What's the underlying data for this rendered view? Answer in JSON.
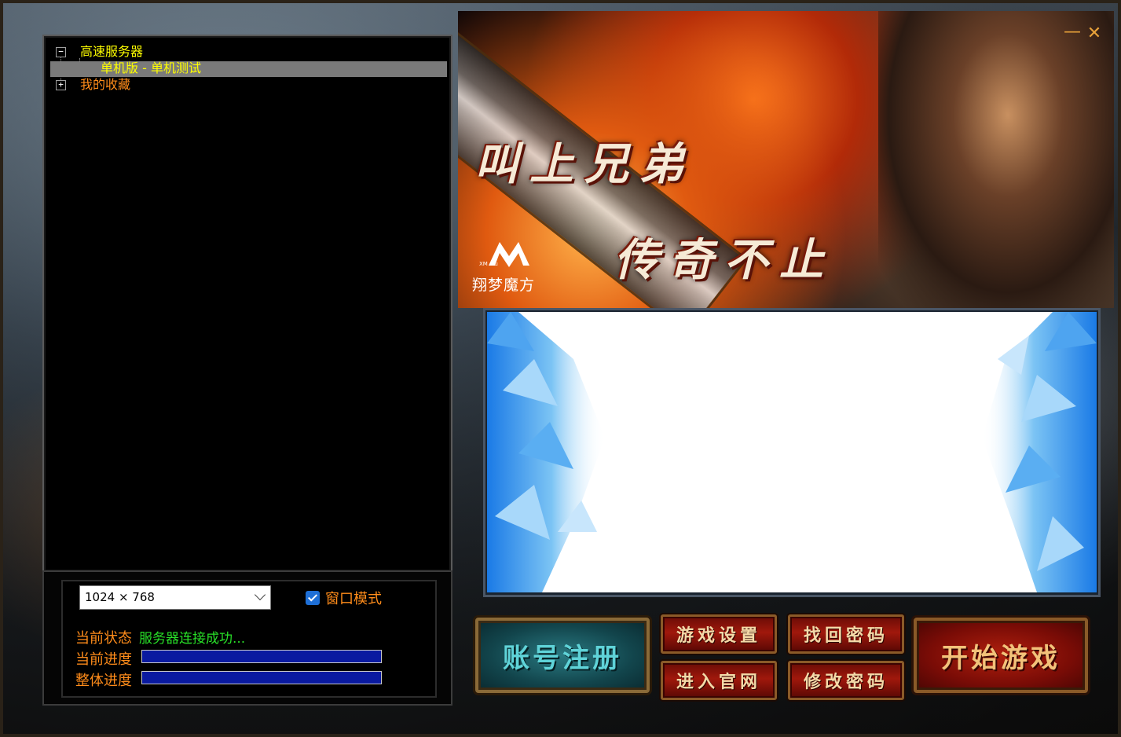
{
  "server_tree": {
    "items": [
      {
        "label": "高速服务器",
        "expander": "−",
        "color": "#ffff00"
      },
      {
        "label": "单机版 - 单机测试",
        "color": "#ffff00",
        "selected": true
      },
      {
        "label": "我的收藏",
        "expander": "+",
        "color": "#ff8c1a"
      }
    ]
  },
  "controls": {
    "resolution": "1024 × 768",
    "window_mode_label": "窗口模式",
    "window_mode_checked": true,
    "status_label": "当前状态",
    "status_value": "服务器连接成功...",
    "current_progress_label": "当前进度",
    "overall_progress_label": "整体进度"
  },
  "banner": {
    "slogan_line1": "叫上兄弟",
    "slogan_line2": "传奇不止",
    "logo_small": "XM cfu",
    "logo_text": "翔梦魔方",
    "minimize_glyph": "—",
    "close_glyph": "✕"
  },
  "buttons": {
    "register": "账号注册",
    "game_settings": "游戏设置",
    "recover_password": "找回密码",
    "official_site": "进入官网",
    "change_password": "修改密码",
    "start_game": "开始游戏"
  },
  "colors": {
    "tree_highlight": "#ffff00",
    "orange_label": "#ff8c1a",
    "status_green": "#28e028",
    "progress_blue": "#0a1aa0",
    "accent_blue": "#1e6fd6"
  }
}
